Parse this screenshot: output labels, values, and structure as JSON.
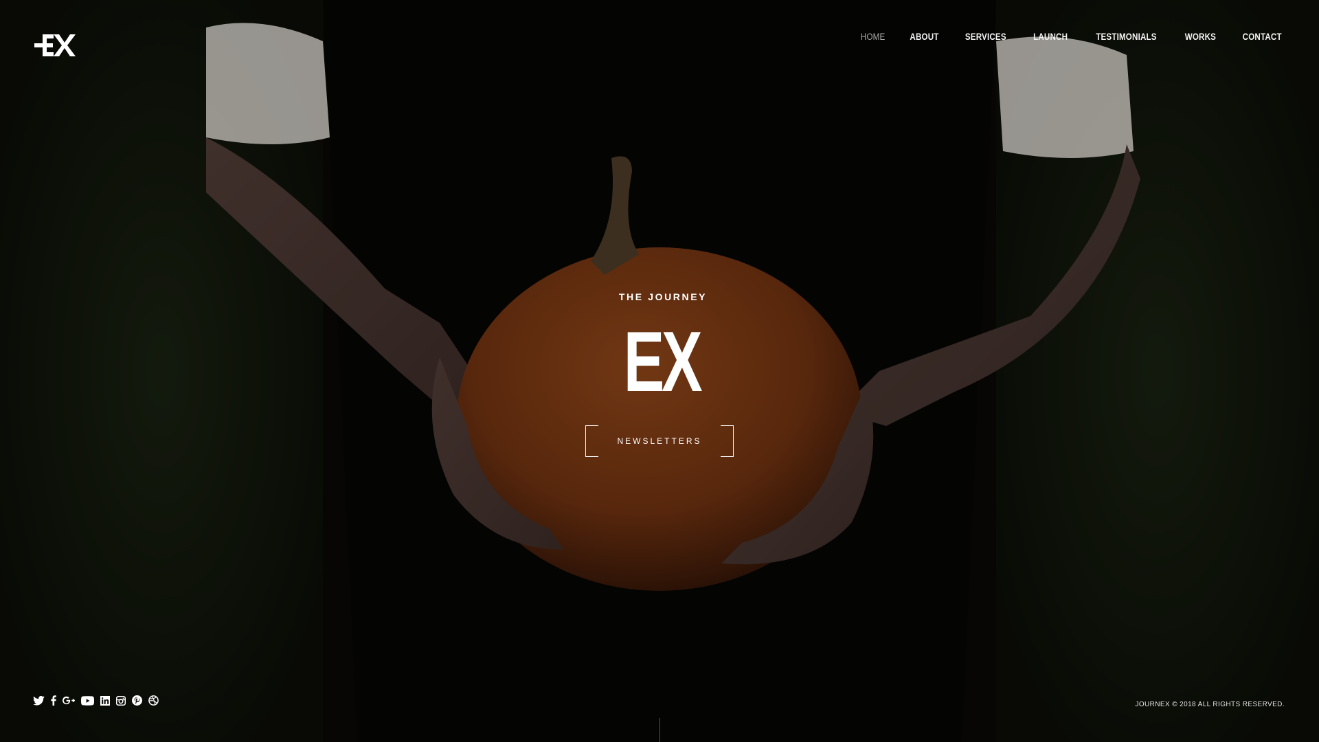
{
  "brand": {
    "logo_text": "EX"
  },
  "nav": {
    "items": [
      {
        "label": "HOME",
        "active": true
      },
      {
        "label": "ABOUT",
        "active": false
      },
      {
        "label": "SERVICES",
        "active": false
      },
      {
        "label": "LAUNCH",
        "active": false
      },
      {
        "label": "TESTIMONIALS",
        "active": false
      },
      {
        "label": "WORKS",
        "active": false
      },
      {
        "label": "CONTACT",
        "active": false
      }
    ]
  },
  "hero": {
    "eyebrow": "THE JOURNEY",
    "title": "EX",
    "cta_label": "NEWSLETTERS",
    "background": "dark photo of hands holding a pumpkin"
  },
  "social": {
    "icons": [
      "twitter-icon",
      "facebook-icon",
      "google-plus-icon",
      "youtube-icon",
      "linkedin-icon",
      "instagram-icon",
      "pinterest-icon",
      "dribbble-icon"
    ]
  },
  "footer": {
    "copyright": "JOURNEX © 2018 ALL RIGHTS RESERVED."
  },
  "colors": {
    "accent": "#ffffff",
    "nav_active": "#a9a9a9",
    "background": "#0a0806",
    "pumpkin": "#7a3a14"
  }
}
